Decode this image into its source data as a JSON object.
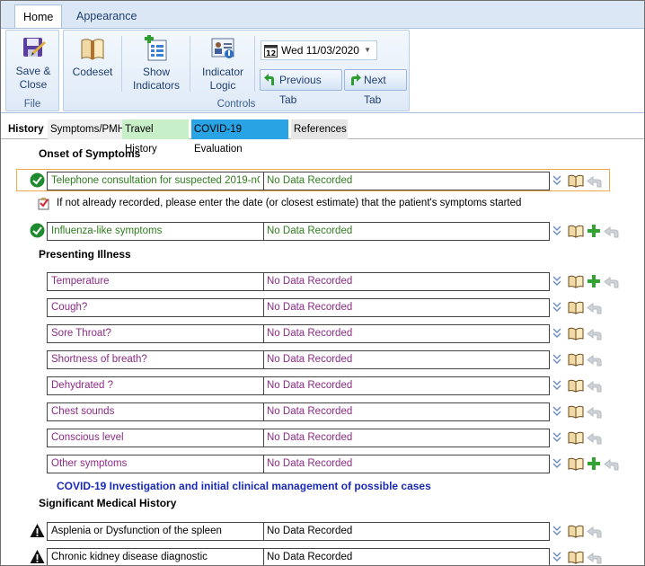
{
  "ribbon": {
    "tabs": [
      {
        "label": "Home",
        "active": true
      },
      {
        "label": "Appearance",
        "active": false
      }
    ],
    "groups": {
      "file": {
        "label": "File",
        "save_close": "Save &\nClose"
      },
      "controls": {
        "label": "Controls",
        "codeset": "Codeset",
        "show_indicators": "Show\nIndicators",
        "indicator_logic": "Indicator\nLogic",
        "date": "Wed 11/03/2020",
        "previous_tab": "Previous Tab",
        "next_tab": "Next Tab"
      }
    }
  },
  "page_tabs": [
    {
      "label": "History",
      "style": "bold"
    },
    {
      "label": "Symptoms/PMH",
      "style": "normal"
    },
    {
      "label": "Travel History",
      "style": "travel"
    },
    {
      "label": "COVID-19 Evaluation",
      "style": "covid"
    },
    {
      "label": "References",
      "style": "refs"
    }
  ],
  "sections": {
    "onset": "Onset of Symptoms",
    "presenting": "Presenting Illness",
    "significant": "Significant Medical History"
  },
  "onset_rows": [
    {
      "label": "Telephone consultation for suspected 2019-nC...",
      "value": "No Data Recorded",
      "color": "green",
      "status": "check",
      "highlighted": true,
      "add": false
    },
    {
      "label": "Influenza-like symptoms",
      "value": "No Data Recorded",
      "color": "green",
      "status": "check",
      "highlighted": false,
      "add": true
    }
  ],
  "onset_note": "If not already recorded, please enter the date (or closest estimate) that the patient's symptoms started",
  "presenting_rows": [
    {
      "label": "Temperature",
      "value": "No Data Recorded",
      "add": true
    },
    {
      "label": "Cough?",
      "value": "No Data Recorded",
      "add": false
    },
    {
      "label": "Sore Throat?",
      "value": "No Data Recorded",
      "add": false
    },
    {
      "label": "Shortness of breath?",
      "value": "No Data Recorded",
      "add": false
    },
    {
      "label": "Dehydrated ?",
      "value": "No Data Recorded",
      "add": false
    },
    {
      "label": "Chest sounds",
      "value": "No Data Recorded",
      "add": false
    },
    {
      "label": "Conscious level",
      "value": "No Data Recorded",
      "add": false
    },
    {
      "label": "Other symptoms",
      "value": "No Data Recorded",
      "add": true
    }
  ],
  "covid_link": "COVID-19 Investigation and initial clinical management of possible cases",
  "history_rows": [
    {
      "label": "Asplenia or Dysfunction of the spleen",
      "value": "No Data Recorded",
      "status": "warning"
    },
    {
      "label": "Chronic kidney disease diagnostic",
      "value": "No Data Recorded",
      "status": "warning"
    }
  ],
  "colors": {
    "green_text": "#2e7d1e",
    "purple_text": "#8b2a86",
    "link": "#1a2ab3",
    "highlight_border": "#f1a851",
    "covid_tab": "#29a3e3",
    "travel_tab": "#c8f0c8"
  }
}
